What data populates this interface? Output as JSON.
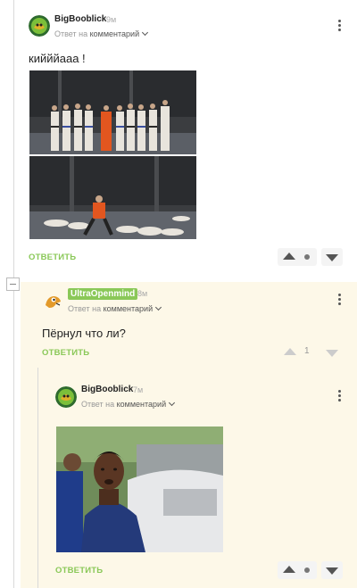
{
  "comments": [
    {
      "author": "BigBooblick",
      "time": "9м",
      "reply_prefix": "Ответ на",
      "reply_target": "комментарий",
      "text": "кийййааа !",
      "reply_label": "ОТВЕТИТЬ",
      "images": [
        "karate-lineup-photo",
        "karate-fallen-opponents-photo"
      ]
    },
    {
      "author": "UltraOpenmind",
      "time": "8м",
      "reply_prefix": "Ответ на",
      "reply_target": "комментарий",
      "text": "Пёрнул что ли?",
      "reply_label": "ОТВЕТИТЬ",
      "rating": "1"
    },
    {
      "author": "BigBooblick",
      "time": "7м",
      "reply_prefix": "Ответ на",
      "reply_target": "комментарий",
      "reply_label": "ОТВЕТИТЬ",
      "images": [
        "man-in-blue-shirt-photo"
      ]
    }
  ],
  "colors": {
    "accent_green": "#8ac858",
    "nested_background": "#fdf8e8"
  },
  "icons": [
    "user-avatar-icon",
    "chevron-down-icon",
    "more-vertical-icon",
    "upvote-icon",
    "downvote-icon",
    "collapse-icon"
  ]
}
